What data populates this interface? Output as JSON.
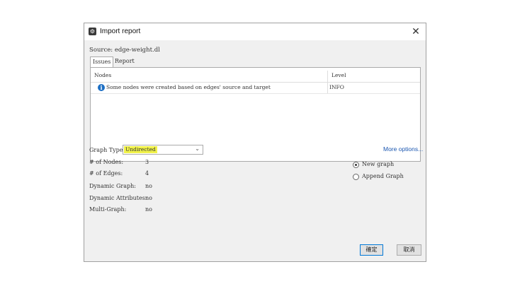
{
  "window": {
    "title": "Import report",
    "close_symbol": "✕",
    "app_icon_symbol": "⚙"
  },
  "source": "Source: edge-weight.dl",
  "tabs": [
    {
      "label": "Issues",
      "active": true
    },
    {
      "label": "Report",
      "active": false
    }
  ],
  "table": {
    "columns": [
      "Nodes",
      "Level"
    ],
    "rows": [
      {
        "message": "Some nodes were created based on edges' source and target",
        "level": "INFO"
      }
    ]
  },
  "graph_type": {
    "label": "Graph Type:",
    "value": "Undirected"
  },
  "more_options": "More options...",
  "stats": [
    {
      "label": "# of Nodes:",
      "value": "3"
    },
    {
      "label": "# of Edges:",
      "value": "4"
    },
    {
      "label": "Dynamic Graph:",
      "value": "no"
    },
    {
      "label": "Dynamic Attributes:",
      "value": "no"
    },
    {
      "label": "Multi-Graph:",
      "value": "no"
    }
  ],
  "options": [
    {
      "label": "New graph",
      "selected": true
    },
    {
      "label": "Append Graph",
      "selected": false
    }
  ],
  "buttons": {
    "ok": "確定",
    "cancel": "取消"
  },
  "colors": {
    "highlight": "#f1f24a",
    "link": "#1a56b0",
    "info_icon": "#1c6fc4"
  }
}
